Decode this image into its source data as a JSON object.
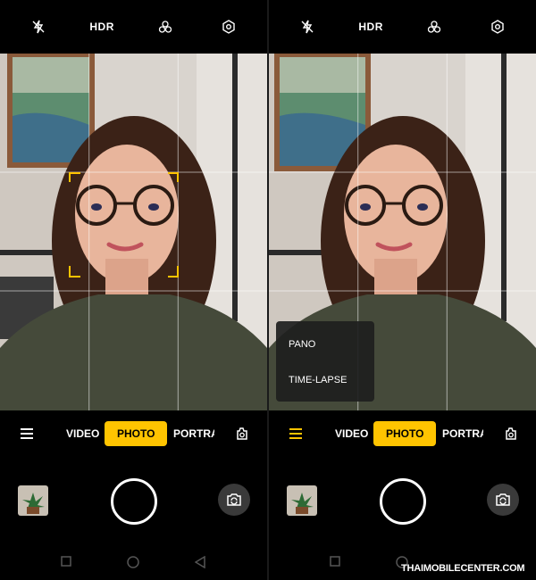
{
  "top_bar": {
    "hdr_label": "HDR"
  },
  "modes": {
    "video": "VIDEO",
    "photo": "PHOTO",
    "portrait": "PORTRAIT"
  },
  "more_menu": {
    "items": [
      "PANO",
      "TIME-LAPSE"
    ]
  },
  "watermark": {
    "text": "THAIMOBILECENTER.COM"
  },
  "colors": {
    "accent": "#ffc400",
    "background": "#000000"
  }
}
